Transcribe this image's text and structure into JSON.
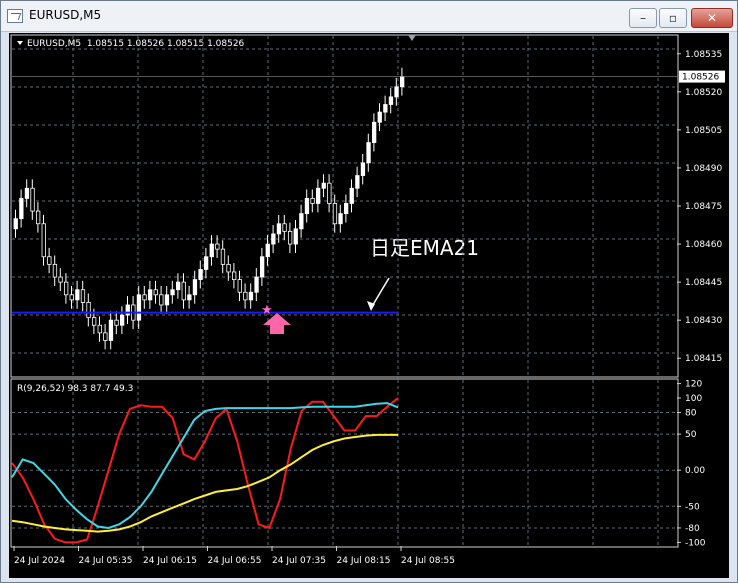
{
  "window": {
    "title": "EURUSD,M5",
    "min_glyph": "–",
    "max_glyph": "▫",
    "close_glyph": "✕"
  },
  "chart_header": {
    "text": "EURUSD,M5  1.08515 1.08526 1.08515 1.08526"
  },
  "price_axis": {
    "ticks": [
      "1.08535",
      "1.08520",
      "1.08505",
      "1.08490",
      "1.08475",
      "1.08460",
      "1.08445",
      "1.08430",
      "1.08415"
    ],
    "current_price": "1.08526"
  },
  "annotation": {
    "text": "日足EMA21"
  },
  "indicator": {
    "label": "R(9,26,52) 98.3 87.7 49.3",
    "ticks": [
      "120",
      "100",
      "80",
      "50",
      "0.00",
      "-50",
      "-80",
      "-100"
    ]
  },
  "time_axis": {
    "labels": [
      "24 Jul 2024",
      "24 Jul 05:35",
      "24 Jul 06:15",
      "24 Jul 06:55",
      "24 Jul 07:35",
      "24 Jul 08:15",
      "24 Jul 08:55"
    ]
  },
  "chart_data": [
    {
      "type": "candlestick",
      "title": "EURUSD,M5",
      "ylim": [
        1.08408,
        1.08542
      ],
      "ohlc_header": [
        1.08515,
        1.08526,
        1.08515,
        1.08526
      ],
      "hline": 1.08433,
      "closes": [
        1.0847,
        1.08478,
        1.08482,
        1.08473,
        1.08468,
        1.08455,
        1.08452,
        1.08447,
        1.08445,
        1.0844,
        1.08438,
        1.08442,
        1.08437,
        1.08431,
        1.08428,
        1.08425,
        1.08422,
        1.0843,
        1.08428,
        1.08432,
        1.08436,
        1.0843,
        1.0844,
        1.08438,
        1.08442,
        1.0844,
        1.08436,
        1.0844,
        1.08442,
        1.08445,
        1.08438,
        1.0844,
        1.08446,
        1.0845,
        1.08455,
        1.0846,
        1.08458,
        1.08452,
        1.08449,
        1.08446,
        1.08441,
        1.08438,
        1.08441,
        1.08447,
        1.08455,
        1.0846,
        1.08464,
        1.08468,
        1.08465,
        1.0846,
        1.08466,
        1.08472,
        1.08478,
        1.08476,
        1.08482,
        1.08484,
        1.08476,
        1.08468,
        1.08472,
        1.08476,
        1.08482,
        1.08487,
        1.08492,
        1.085,
        1.08508,
        1.08512,
        1.08515,
        1.08518,
        1.08522,
        1.08526
      ]
    },
    {
      "type": "line",
      "title": "R(9,26,52)",
      "ylim": [
        -105,
        125
      ],
      "series": [
        {
          "name": "",
          "color": "#ff1a1a",
          "values": [
            10,
            -10,
            -40,
            -75,
            -95,
            -100,
            -100,
            -96,
            -50,
            0,
            50,
            85,
            90,
            88,
            88,
            72,
            22,
            15,
            40,
            72,
            85,
            40,
            -20,
            -75,
            -80,
            -40,
            30,
            82,
            95,
            95,
            75,
            55,
            55,
            75,
            75,
            88,
            100
          ]
        },
        {
          "name": "",
          "color": "#3fd6e8",
          "values": [
            -10,
            15,
            10,
            -5,
            -20,
            -40,
            -55,
            -68,
            -78,
            -80,
            -75,
            -65,
            -50,
            -30,
            -5,
            20,
            45,
            70,
            82,
            85,
            86,
            86,
            86,
            86,
            86,
            86,
            86,
            87,
            88,
            88,
            88,
            88,
            88,
            90,
            92,
            93,
            87
          ]
        },
        {
          "name": "",
          "color": "#ffee33",
          "values": [
            -70,
            -72,
            -75,
            -78,
            -80,
            -82,
            -83,
            -84,
            -85,
            -84,
            -82,
            -78,
            -72,
            -64,
            -58,
            -52,
            -46,
            -40,
            -35,
            -30,
            -28,
            -26,
            -22,
            -16,
            -10,
            0,
            8,
            18,
            28,
            35,
            40,
            44,
            46,
            48,
            49,
            49,
            49
          ]
        }
      ]
    }
  ]
}
